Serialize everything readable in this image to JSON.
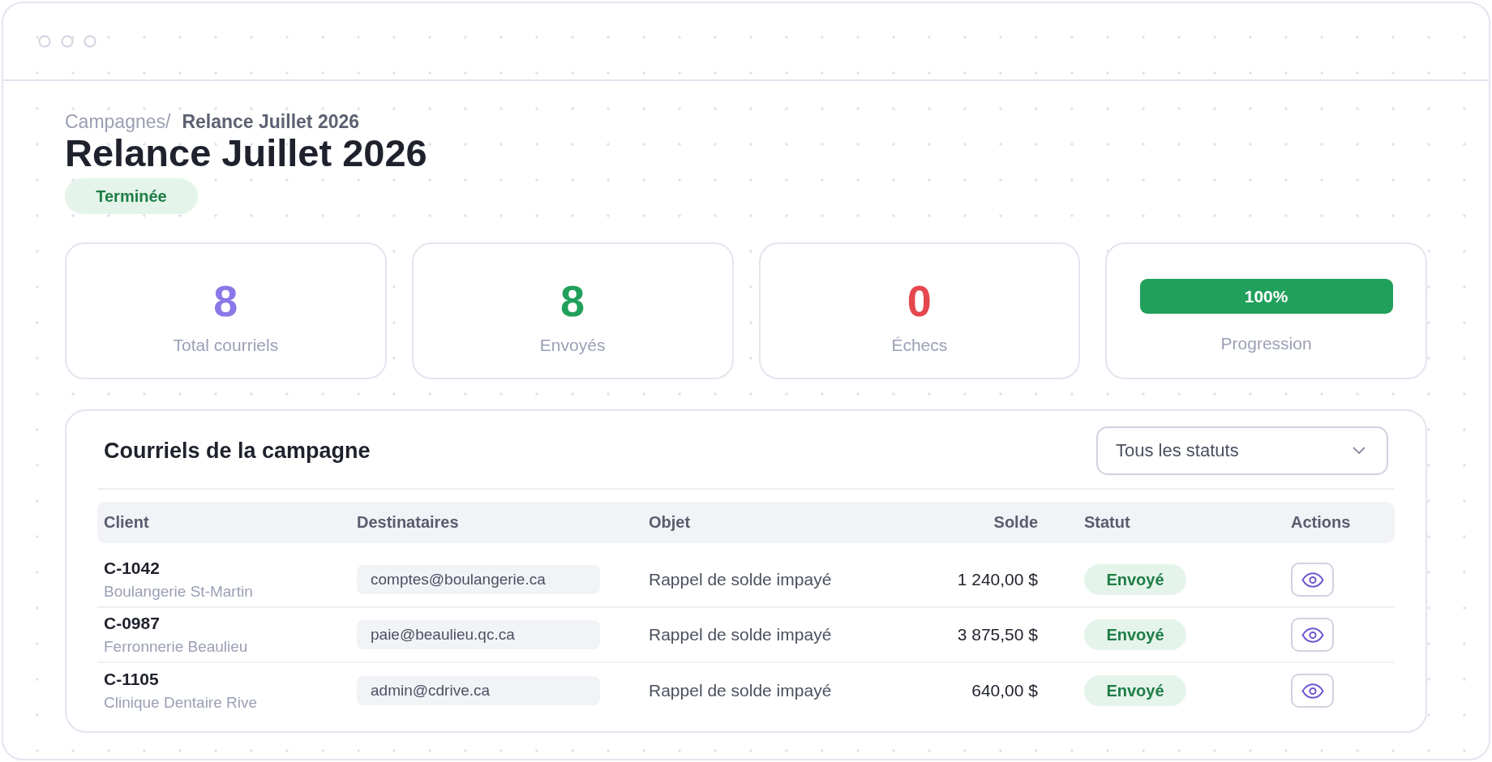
{
  "breadcrumb": {
    "parent": "Campagnes/",
    "current": "Relance Juillet 2026"
  },
  "title": "Relance Juillet 2026",
  "status_badge": {
    "label": "Terminée",
    "kind": "success"
  },
  "stats": [
    {
      "kind": "count",
      "value": "8",
      "label": "Total courriels",
      "color": "#8a78e8"
    },
    {
      "kind": "count",
      "value": "8",
      "label": "Envoyés",
      "color": "#21a05b"
    },
    {
      "kind": "count",
      "value": "0",
      "label": "Échecs",
      "color": "#e5474d"
    },
    {
      "kind": "progress",
      "level": 1,
      "reading": "100%",
      "label": "Progression"
    }
  ],
  "table": {
    "title": "Courriels de la campagne",
    "filter": {
      "value": "Tous les statuts"
    },
    "columns": [
      "Client",
      "Destinataires",
      "Objet",
      "Solde",
      "Statut",
      "Actions"
    ],
    "rows": [
      {
        "client_id": "C-1042",
        "client_name": "Boulangerie St-Martin",
        "recipients": "comptes@boulangerie.ca",
        "subject": "Rappel de solde impayé",
        "balance": "1 240,00 $",
        "status": {
          "label": "Envoyé",
          "kind": "success"
        }
      },
      {
        "client_id": "C-0987",
        "client_name": "Ferronnerie Beaulieu",
        "recipients": "paie@beaulieu.qc.ca",
        "subject": "Rappel de solde impayé",
        "balance": "3 875,50 $",
        "status": {
          "label": "Envoyé",
          "kind": "success"
        }
      },
      {
        "client_id": "C-1105",
        "client_name": "Clinique Dentaire Rive",
        "recipients": "admin@cdrive.ca",
        "subject": "Rappel de solde impayé",
        "balance": "640,00 $",
        "status": {
          "label": "Envoyé",
          "kind": "success"
        }
      }
    ]
  }
}
